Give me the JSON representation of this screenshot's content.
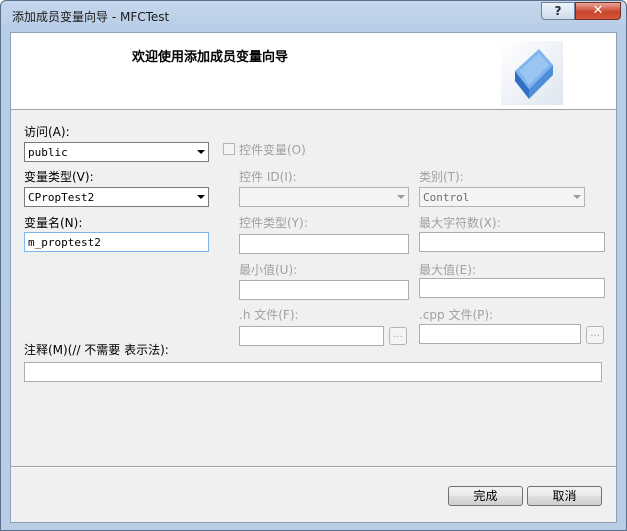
{
  "window": {
    "title": "添加成员变量向导 - MFCTest",
    "help_label": "?",
    "close_label": "✕"
  },
  "header": {
    "title": "欢迎使用添加成员变量向导",
    "logo_icon": "wizard-cube-icon"
  },
  "form": {
    "access_label": "访问(A):",
    "access_value": "public",
    "control_var_label": "控件变量(O)",
    "var_type_label": "变量类型(V):",
    "var_type_value": "CPropTest2",
    "var_name_label": "变量名(N):",
    "var_name_value": "m_proptest2",
    "control_id_label": "控件 ID(I):",
    "control_id_value": "",
    "category_label": "类别(T):",
    "category_value": "Control",
    "control_type_label": "控件类型(Y):",
    "control_type_value": "",
    "max_chars_label": "最大字符数(X):",
    "max_chars_value": "",
    "min_value_label": "最小值(U):",
    "min_value_value": "",
    "max_value_label": "最大值(E):",
    "max_value_value": "",
    "h_file_label": ".h 文件(F):",
    "h_file_value": "",
    "cpp_file_label": ".cpp 文件(P):",
    "cpp_file_value": "",
    "browse_label": "...",
    "comment_label": "注释(M)(// 不需要 表示法):",
    "comment_value": ""
  },
  "buttons": {
    "finish_label": "完成",
    "cancel_label": "取消"
  }
}
